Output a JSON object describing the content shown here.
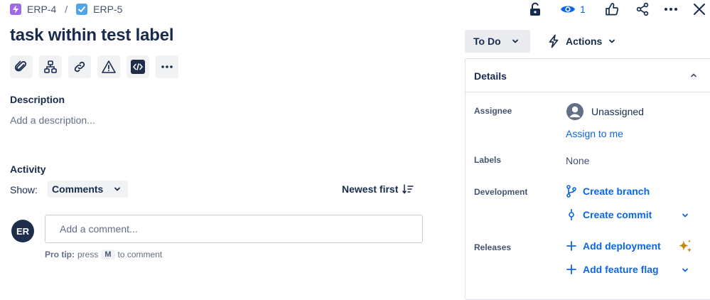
{
  "breadcrumb": {
    "parent_key": "ERP-4",
    "separator": "/",
    "issue_key": "ERP-5"
  },
  "issue": {
    "title": "task within test label"
  },
  "description": {
    "heading": "Description",
    "placeholder": "Add a description..."
  },
  "activity": {
    "heading": "Activity",
    "show_label": "Show:",
    "show_value": "Comments",
    "sort_label": "Newest first"
  },
  "comment": {
    "avatar_initials": "ER",
    "placeholder": "Add a comment...",
    "protip_lead": "Pro tip:",
    "protip_text": "press",
    "protip_key": "M",
    "protip_tail": "to comment"
  },
  "header_actions": {
    "watch_count": "1"
  },
  "status": {
    "label": "To Do",
    "actions_label": "Actions"
  },
  "details": {
    "heading": "Details",
    "assignee_label": "Assignee",
    "assignee_value": "Unassigned",
    "assign_to_me": "Assign to me",
    "labels_label": "Labels",
    "labels_value": "None",
    "development_label": "Development",
    "create_branch": "Create branch",
    "create_commit": "Create commit",
    "releases_label": "Releases",
    "add_deployment": "Add deployment",
    "add_feature_flag": "Add feature flag"
  },
  "colors": {
    "text": "#172b4d",
    "link": "#0c66e4",
    "epic": "#9f6ae8",
    "task": "#4ea6e8"
  }
}
